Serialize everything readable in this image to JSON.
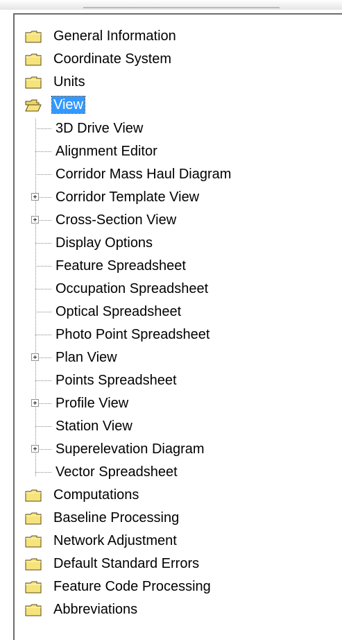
{
  "tree": {
    "top_folders": [
      {
        "label": "General Information",
        "icon": "folder-icon"
      },
      {
        "label": "Coordinate System",
        "icon": "folder-icon"
      },
      {
        "label": "Units",
        "icon": "folder-icon"
      }
    ],
    "open_folder": {
      "label": "View",
      "icon": "open-folder-icon",
      "selected": true
    },
    "view_children": [
      {
        "label": "3D Drive View",
        "expandable": false
      },
      {
        "label": "Alignment Editor",
        "expandable": false
      },
      {
        "label": "Corridor Mass Haul Diagram",
        "expandable": false
      },
      {
        "label": "Corridor Template View",
        "expandable": true
      },
      {
        "label": "Cross-Section View",
        "expandable": true
      },
      {
        "label": "Display Options",
        "expandable": false
      },
      {
        "label": "Feature Spreadsheet",
        "expandable": false
      },
      {
        "label": "Occupation Spreadsheet",
        "expandable": false
      },
      {
        "label": "Optical Spreadsheet",
        "expandable": false
      },
      {
        "label": "Photo Point Spreadsheet",
        "expandable": false
      },
      {
        "label": "Plan View",
        "expandable": true
      },
      {
        "label": "Points Spreadsheet",
        "expandable": false
      },
      {
        "label": "Profile View",
        "expandable": true
      },
      {
        "label": "Station View",
        "expandable": false
      },
      {
        "label": "Superelevation Diagram",
        "expandable": true
      },
      {
        "label": "Vector Spreadsheet",
        "expandable": false
      }
    ],
    "bottom_folders": [
      {
        "label": "Computations",
        "icon": "folder-icon"
      },
      {
        "label": "Baseline Processing",
        "icon": "folder-icon"
      },
      {
        "label": "Network Adjustment",
        "icon": "folder-icon"
      },
      {
        "label": "Default Standard Errors",
        "icon": "folder-icon"
      },
      {
        "label": "Feature Code Processing",
        "icon": "folder-icon"
      },
      {
        "label": "Abbreviations",
        "icon": "folder-icon"
      }
    ]
  },
  "colors": {
    "selection": "#3399ff",
    "folder": "#f6e37b",
    "tree_line": "#8a8a8a"
  }
}
